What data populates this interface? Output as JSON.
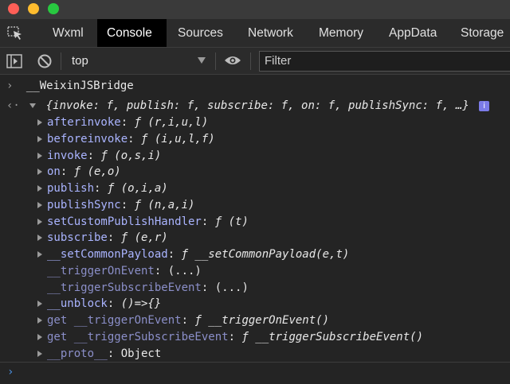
{
  "tabs": [
    {
      "label": "Wxml",
      "active": false
    },
    {
      "label": "Console",
      "active": true
    },
    {
      "label": "Sources",
      "active": false
    },
    {
      "label": "Network",
      "active": false
    },
    {
      "label": "Memory",
      "active": false
    },
    {
      "label": "AppData",
      "active": false
    },
    {
      "label": "Storage",
      "active": false
    }
  ],
  "toolbar": {
    "context": "top",
    "filter_placeholder": "Filter"
  },
  "console": {
    "input_expr": "__WeixinJSBridge",
    "result_summary": "{invoke: f, publish: f, subscribe: f, on: f, publishSync: f, …}",
    "properties": [
      {
        "key": "afterinvoke",
        "value": "ƒ (r,i,u,l)",
        "expandable": true
      },
      {
        "key": "beforeinvoke",
        "value": "ƒ (i,u,l,f)",
        "expandable": true
      },
      {
        "key": "invoke",
        "value": "ƒ (o,s,i)",
        "expandable": true
      },
      {
        "key": "on",
        "value": "ƒ (e,o)",
        "expandable": true
      },
      {
        "key": "publish",
        "value": "ƒ (o,i,a)",
        "expandable": true
      },
      {
        "key": "publishSync",
        "value": "ƒ (n,a,i)",
        "expandable": true
      },
      {
        "key": "setCustomPublishHandler",
        "value": "ƒ (t)",
        "expandable": true
      },
      {
        "key": "subscribe",
        "value": "ƒ (e,r)",
        "expandable": true
      },
      {
        "key": "__setCommonPayload",
        "value": "ƒ __setCommonPayload(e,t)",
        "expandable": true
      },
      {
        "key": "__triggerOnEvent",
        "value": "(...)",
        "expandable": false
      },
      {
        "key": "__triggerSubscribeEvent",
        "value": "(...)",
        "expandable": false
      },
      {
        "key": "__unblock",
        "value": "()=>{}",
        "expandable": true
      },
      {
        "key": "get __triggerOnEvent",
        "value": "ƒ __triggerOnEvent()",
        "expandable": true
      },
      {
        "key": "get __triggerSubscribeEvent",
        "value": "ƒ __triggerSubscribeEvent()",
        "expandable": true
      },
      {
        "key": "__proto__",
        "value": "Object",
        "expandable": true
      }
    ]
  }
}
